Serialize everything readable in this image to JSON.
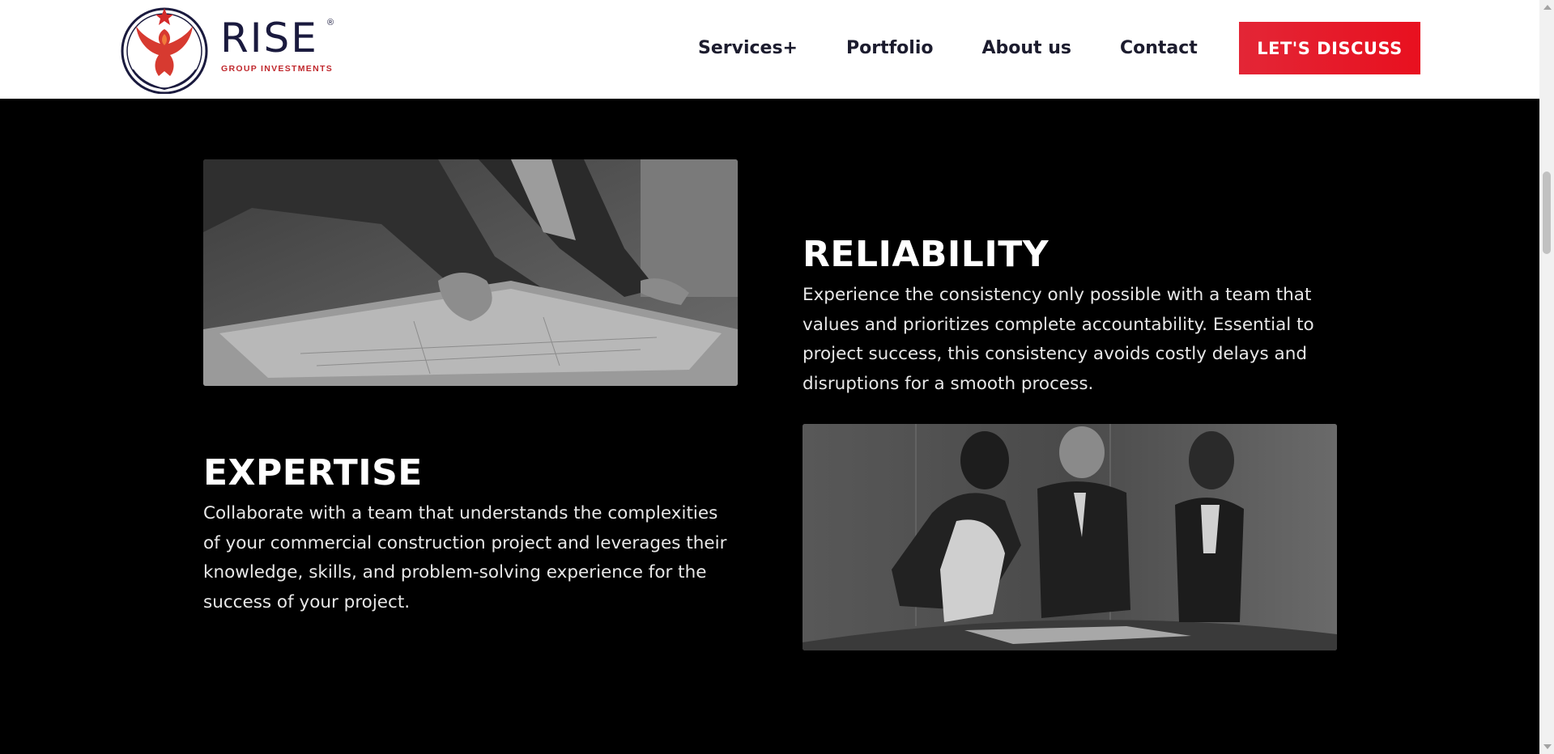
{
  "header": {
    "logo_word": "RISE",
    "logo_reg": "®",
    "logo_sub": "GROUP INVESTMENTS",
    "nav": [
      "Services+",
      "Portfolio",
      "About us",
      "Contact"
    ],
    "cta": "LET'S DISCUSS"
  },
  "sections": {
    "reliability": {
      "title": "RELIABILITY",
      "body": "Experience the consistency only possible with a team that values and prioritizes complete accountability. Essential to project success, this consistency avoids costly delays and disruptions for a smooth process."
    },
    "expertise": {
      "title": "EXPERTISE",
      "body": "Collaborate with a team that understands the complexities of your commercial construction project and leverages their knowledge, skills, and problem-solving experience for the success of your project."
    }
  },
  "colors": {
    "brand_red": "#e8101f",
    "brand_navy": "#1a1a3e",
    "background": "#000000"
  }
}
